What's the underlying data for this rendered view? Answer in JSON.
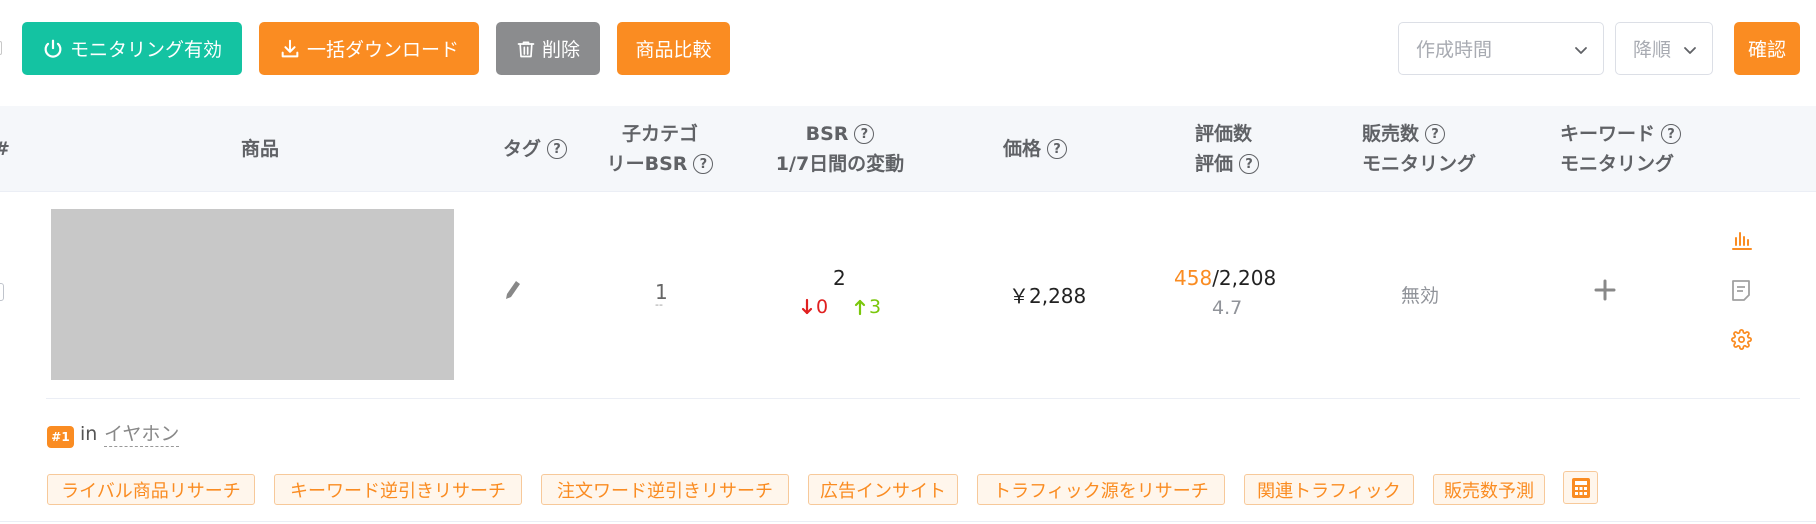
{
  "toolbar": {
    "monitor_label": "モニタリング有効",
    "download_label": "一括ダウンロード",
    "delete_label": "削除",
    "compare_label": "商品比較",
    "confirm_label": "確認",
    "sort_placeholder": "作成時間",
    "order_placeholder": "降順"
  },
  "table": {
    "headers": {
      "index": "#",
      "product": "商品",
      "tag": "タグ",
      "sub_bsr_line1": "子カテゴ",
      "sub_bsr_line2": "リーBSR",
      "bsr_line1": "BSR",
      "bsr_line2": "1/7日間の変動",
      "price": "価格",
      "reviews_line1": "評価数",
      "reviews_line2": "評価",
      "sales_line1": "販売数",
      "sales_line2": "モニタリング",
      "keyword_line1": "キーワード",
      "keyword_line2": "モニタリング"
    },
    "row": {
      "sub_bsr": "1",
      "sub_bsr_sub": "--",
      "bsr": "2",
      "bsr_down": "0",
      "bsr_up": "3",
      "price": "￥2,288",
      "review_count": "458",
      "review_total": "/2,208",
      "rating": "4.7",
      "sales_monitoring": "無効",
      "rank_badge": "#1",
      "rank_in": "in",
      "rank_category": "イヤホン",
      "tags": [
        "ライバル商品リサーチ",
        "キーワード逆引きリサーチ",
        "注文ワード逆引きリサーチ",
        "広告インサイト",
        "トラフィック源をリサーチ",
        "関連トラフィック",
        "販売数予測"
      ]
    }
  },
  "colors": {
    "teal": "#14c3a2",
    "orange": "#fa8c22",
    "gray_button": "#8b8c8e",
    "down_red": "#e02020",
    "up_green": "#7ac70c"
  },
  "icons": [
    "power-icon",
    "download-icon",
    "trash-icon",
    "chevron-down-icon",
    "help-icon",
    "pencil-icon",
    "arrow-down-icon",
    "arrow-up-icon",
    "plus-icon",
    "bar-chart-icon",
    "notes-icon",
    "gear-icon",
    "calculator-icon"
  ]
}
